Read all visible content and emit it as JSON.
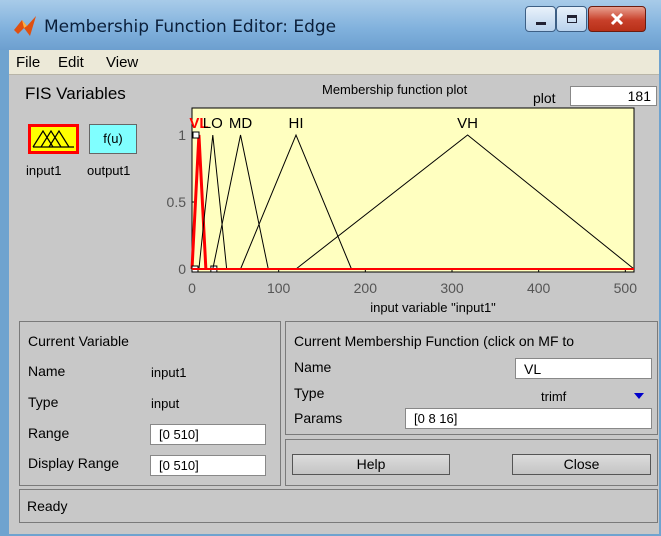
{
  "window": {
    "title": "Membership Function Editor: Edge",
    "icons": [
      "matlab-icon",
      "minimize-icon",
      "maximize-icon",
      "close-icon"
    ]
  },
  "menubar": [
    "File",
    "Edit",
    "View"
  ],
  "fis_variables": {
    "title": "FIS Variables",
    "input": {
      "label": "input1",
      "icon": "membership-triangles-icon"
    },
    "output": {
      "label": "output1",
      "icon_text": "f(u)"
    }
  },
  "plot": {
    "title": "Membership function plot",
    "points_label": "plot",
    "points_value": "181",
    "x_axis_label": "input variable \"input1\""
  },
  "chart_data": {
    "type": "line",
    "title": "Membership function plot",
    "xlabel": "input variable \"input1\"",
    "ylabel": "",
    "xlim": [
      0,
      510
    ],
    "ylim": [
      0,
      1
    ],
    "xticks": [
      0,
      100,
      200,
      300,
      400,
      500
    ],
    "yticks": [
      0,
      0.5,
      1
    ],
    "background": "#ffffc0",
    "series": [
      {
        "name": "VL",
        "points": [
          [
            0,
            0
          ],
          [
            8,
            1
          ],
          [
            16,
            0
          ]
        ],
        "selected": true
      },
      {
        "name": "LO",
        "points": [
          [
            8,
            0
          ],
          [
            24,
            1
          ],
          [
            40,
            0
          ]
        ],
        "selected": false
      },
      {
        "name": "MD",
        "points": [
          [
            24,
            0
          ],
          [
            56,
            1
          ],
          [
            88,
            0
          ]
        ],
        "selected": false
      },
      {
        "name": "HI",
        "points": [
          [
            56,
            0
          ],
          [
            120,
            1
          ],
          [
            184,
            0
          ]
        ],
        "selected": false
      },
      {
        "name": "VH",
        "points": [
          [
            120,
            0
          ],
          [
            318,
            1
          ],
          [
            510,
            0
          ]
        ],
        "selected": false
      }
    ]
  },
  "current_variable": {
    "title": "Current Variable",
    "name_label": "Name",
    "name_value": "input1",
    "type_label": "Type",
    "type_value": "input",
    "range_label": "Range",
    "range_value": "[0 510]",
    "display_range_label": "Display Range",
    "display_range_value": "[0 510]"
  },
  "current_mf": {
    "title": "Current Membership Function (click on MF to",
    "name_label": "Name",
    "name_value": "VL",
    "type_label": "Type",
    "type_value": "trimf",
    "params_label": "Params",
    "params_value": "[0 8 16]"
  },
  "buttons": {
    "help": "Help",
    "close": "Close"
  },
  "status": "Ready",
  "colors": {
    "selected_mf": "#ff0000",
    "plot_bg": "#ffffc0",
    "panel_bg": "#c8c8c8",
    "output_box": "#80ffff",
    "input_box": "#ffff00"
  }
}
